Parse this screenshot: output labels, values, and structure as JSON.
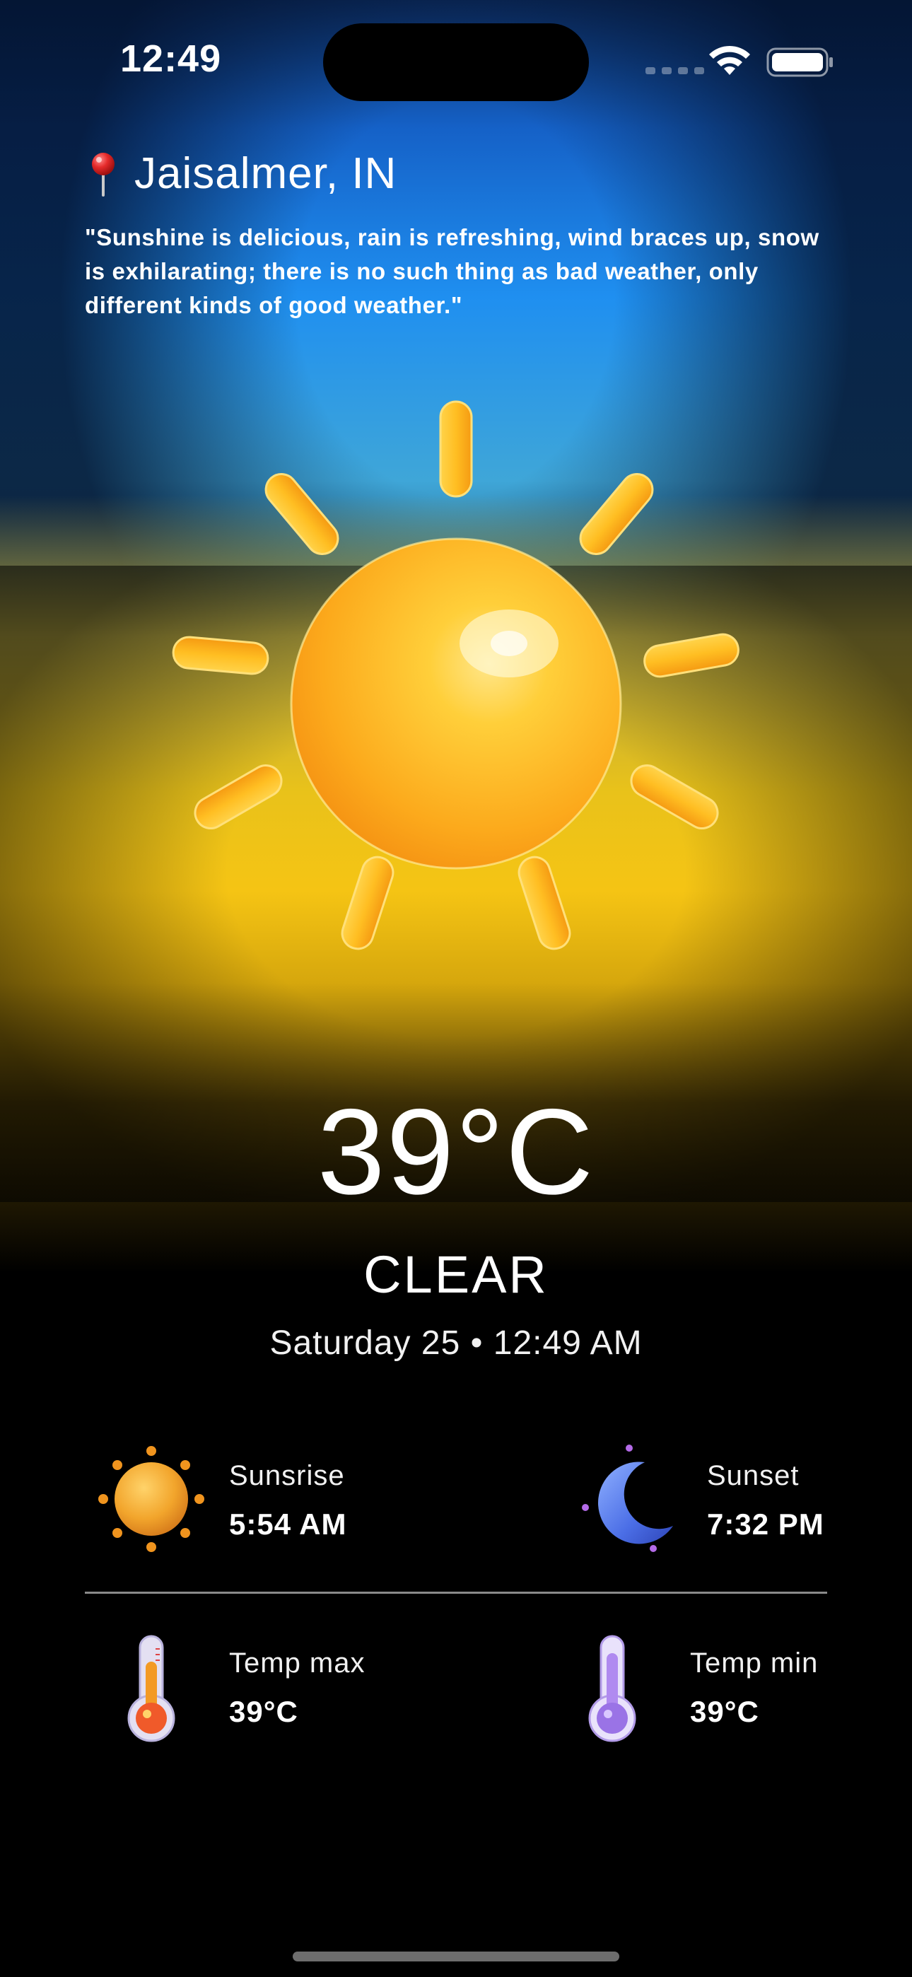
{
  "status_bar": {
    "time": "12:49"
  },
  "location": {
    "name": "Jaisalmer, IN",
    "icon": "pin-icon"
  },
  "quote": "\"Sunshine is delicious, rain is refreshing, wind braces up, snow is exhilarating; there is no such thing as bad weather, only different kinds of good weather.\"",
  "weather": {
    "icon": "sun-icon",
    "temperature": "39°C",
    "condition": "CLEAR",
    "datetime": "Saturday 25 • 12:49 AM"
  },
  "details": {
    "sunrise": {
      "label": "Sunsrise",
      "value": "5:54 AM",
      "icon": "sunrise-icon"
    },
    "sunset": {
      "label": "Sunset",
      "value": "7:32 PM",
      "icon": "moon-icon"
    },
    "temp_max": {
      "label": "Temp max",
      "value": "39°C",
      "icon": "thermometer-hot-icon"
    },
    "temp_min": {
      "label": "Temp min",
      "value": "39°C",
      "icon": "thermometer-cold-icon"
    }
  },
  "colors": {
    "sky_blue": "#1f8ff0",
    "sun_yellow": "#f5c414",
    "background": "#000000"
  }
}
